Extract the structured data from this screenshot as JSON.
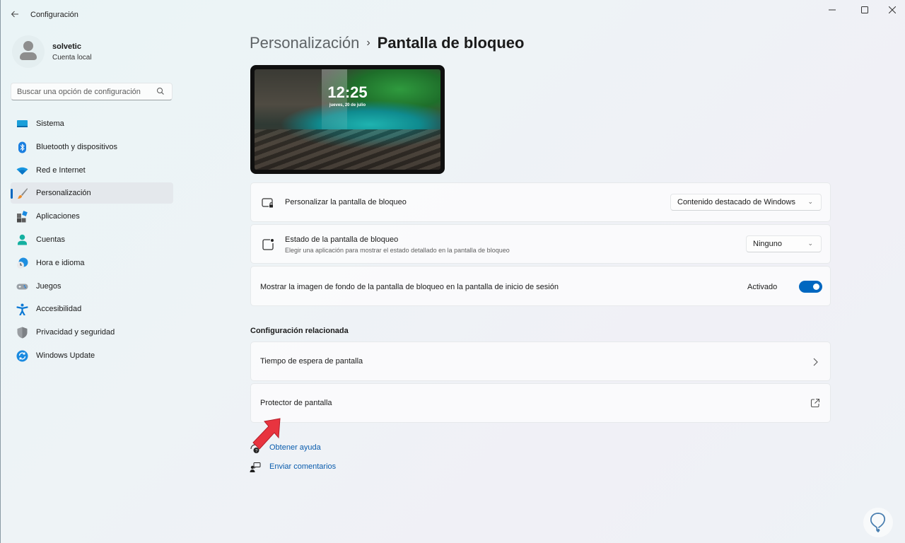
{
  "window": {
    "title": "Configuración",
    "back_icon": "arrow-left-icon",
    "controls": {
      "minimize": "—",
      "maximize": "☐",
      "close": "✕"
    }
  },
  "profile": {
    "name": "solvetic",
    "account_type": "Cuenta local"
  },
  "search": {
    "placeholder": "Buscar una opción de configuración",
    "value": ""
  },
  "sidebar": {
    "items": [
      {
        "label": "Sistema",
        "icon": "monitor-icon",
        "active": false
      },
      {
        "label": "Bluetooth y dispositivos",
        "icon": "bluetooth-icon",
        "active": false
      },
      {
        "label": "Red e Internet",
        "icon": "wifi-icon",
        "active": false
      },
      {
        "label": "Personalización",
        "icon": "paintbrush-icon",
        "active": true
      },
      {
        "label": "Aplicaciones",
        "icon": "apps-icon",
        "active": false
      },
      {
        "label": "Cuentas",
        "icon": "person-icon",
        "active": false
      },
      {
        "label": "Hora e idioma",
        "icon": "clock-globe-icon",
        "active": false
      },
      {
        "label": "Juegos",
        "icon": "gamepad-icon",
        "active": false
      },
      {
        "label": "Accesibilidad",
        "icon": "accessibility-icon",
        "active": false
      },
      {
        "label": "Privacidad y seguridad",
        "icon": "shield-icon",
        "active": false
      },
      {
        "label": "Windows Update",
        "icon": "update-icon",
        "active": false
      }
    ]
  },
  "breadcrumb": {
    "parent": "Personalización",
    "separator": "›",
    "current": "Pantalla de bloqueo"
  },
  "preview": {
    "time": "12:25",
    "date": "jueves, 20 de julio"
  },
  "settings": {
    "personalize": {
      "title": "Personalizar la pantalla de bloqueo",
      "selected": "Contenido destacado de Windows"
    },
    "status": {
      "title": "Estado de la pantalla de bloqueo",
      "description": "Elegir una aplicación para mostrar el estado detallado en la pantalla de bloqueo",
      "selected": "Ninguno"
    },
    "signin_background": {
      "title": "Mostrar la imagen de fondo de la pantalla de bloqueo en la pantalla de inicio de sesión",
      "state_label": "Activado",
      "enabled": true
    }
  },
  "related": {
    "heading": "Configuración relacionada",
    "items": [
      {
        "label": "Tiempo de espera de pantalla",
        "end_icon": "chevron-right-icon"
      },
      {
        "label": "Protector de pantalla",
        "end_icon": "external-link-icon"
      }
    ]
  },
  "help": {
    "get_help": "Obtener ayuda",
    "feedback": "Enviar comentarios"
  },
  "colors": {
    "accent": "#0067c0",
    "link": "#0a5cad",
    "annotation_arrow": "#e8343f"
  }
}
